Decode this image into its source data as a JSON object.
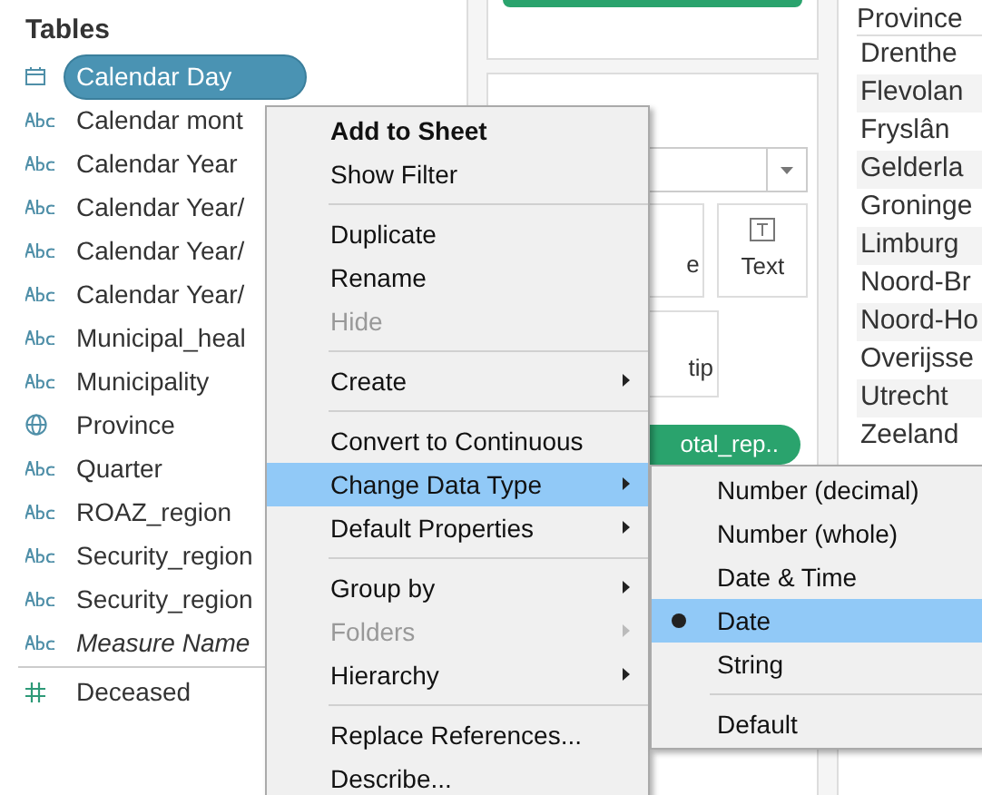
{
  "tables": {
    "title": "Tables",
    "fields": [
      {
        "label": "Calendar Day",
        "kind": "date",
        "italic": false,
        "selected": true
      },
      {
        "label": "Calendar mont",
        "kind": "string",
        "italic": false,
        "selected": false
      },
      {
        "label": "Calendar Year",
        "kind": "string",
        "italic": false,
        "selected": false
      },
      {
        "label": "Calendar Year/",
        "kind": "string",
        "italic": false,
        "selected": false
      },
      {
        "label": "Calendar Year/",
        "kind": "string",
        "italic": false,
        "selected": false
      },
      {
        "label": "Calendar Year/",
        "kind": "string",
        "italic": false,
        "selected": false
      },
      {
        "label": "Municipal_heal",
        "kind": "string",
        "italic": false,
        "selected": false
      },
      {
        "label": "Municipality",
        "kind": "string",
        "italic": false,
        "selected": false
      },
      {
        "label": "Province",
        "kind": "geo",
        "italic": false,
        "selected": false
      },
      {
        "label": "Quarter",
        "kind": "string",
        "italic": false,
        "selected": false
      },
      {
        "label": "ROAZ_region",
        "kind": "string",
        "italic": false,
        "selected": false
      },
      {
        "label": "Security_region",
        "kind": "string",
        "italic": false,
        "selected": false
      },
      {
        "label": "Security_region",
        "kind": "string",
        "italic": false,
        "selected": false
      },
      {
        "label": "Measure Name",
        "kind": "string",
        "italic": true,
        "selected": false
      }
    ],
    "measures": [
      {
        "label": "Deceased",
        "kind": "number",
        "italic": false,
        "selected": false
      }
    ]
  },
  "marks": {
    "buttons": [
      {
        "label": "e"
      },
      {
        "label": "Text"
      },
      {
        "label": "tip"
      }
    ],
    "pill": "otal_rep.."
  },
  "table": {
    "column": "Province",
    "rows": [
      "Drenthe",
      "Flevolan",
      "Fryslân",
      "Gelderla",
      "Groninge",
      "Limburg",
      "Noord-Br",
      "Noord-Ho",
      "Overijsse",
      "Utrecht",
      "Zeeland"
    ]
  },
  "context_menu": [
    {
      "kind": "item",
      "label": "Add to Sheet",
      "bold": true,
      "disabled": false,
      "submenu": false,
      "highlighted": false
    },
    {
      "kind": "item",
      "label": "Show Filter",
      "bold": false,
      "disabled": false,
      "submenu": false,
      "highlighted": false
    },
    {
      "kind": "separator"
    },
    {
      "kind": "item",
      "label": "Duplicate",
      "bold": false,
      "disabled": false,
      "submenu": false,
      "highlighted": false
    },
    {
      "kind": "item",
      "label": "Rename",
      "bold": false,
      "disabled": false,
      "submenu": false,
      "highlighted": false
    },
    {
      "kind": "item",
      "label": "Hide",
      "bold": false,
      "disabled": true,
      "submenu": false,
      "highlighted": false
    },
    {
      "kind": "separator"
    },
    {
      "kind": "item",
      "label": "Create",
      "bold": false,
      "disabled": false,
      "submenu": true,
      "highlighted": false
    },
    {
      "kind": "separator"
    },
    {
      "kind": "item",
      "label": "Convert to Continuous",
      "bold": false,
      "disabled": false,
      "submenu": false,
      "highlighted": false
    },
    {
      "kind": "item",
      "label": "Change Data Type",
      "bold": false,
      "disabled": false,
      "submenu": true,
      "highlighted": true
    },
    {
      "kind": "item",
      "label": "Default Properties",
      "bold": false,
      "disabled": false,
      "submenu": true,
      "highlighted": false
    },
    {
      "kind": "separator"
    },
    {
      "kind": "item",
      "label": "Group by",
      "bold": false,
      "disabled": false,
      "submenu": true,
      "highlighted": false
    },
    {
      "kind": "item",
      "label": "Folders",
      "bold": false,
      "disabled": true,
      "submenu": true,
      "highlighted": false
    },
    {
      "kind": "item",
      "label": "Hierarchy",
      "bold": false,
      "disabled": false,
      "submenu": true,
      "highlighted": false
    },
    {
      "kind": "separator"
    },
    {
      "kind": "item",
      "label": "Replace References...",
      "bold": false,
      "disabled": false,
      "submenu": false,
      "highlighted": false
    },
    {
      "kind": "item",
      "label": "Describe...",
      "bold": false,
      "disabled": false,
      "submenu": false,
      "highlighted": false
    }
  ],
  "submenu": [
    {
      "kind": "item",
      "label": "Number (decimal)",
      "selected": false
    },
    {
      "kind": "item",
      "label": "Number (whole)",
      "selected": false
    },
    {
      "kind": "item",
      "label": "Date & Time",
      "selected": false
    },
    {
      "kind": "item",
      "label": "Date",
      "selected": true
    },
    {
      "kind": "item",
      "label": "String",
      "selected": false
    },
    {
      "kind": "separator"
    },
    {
      "kind": "item",
      "label": "Default",
      "selected": false
    }
  ]
}
